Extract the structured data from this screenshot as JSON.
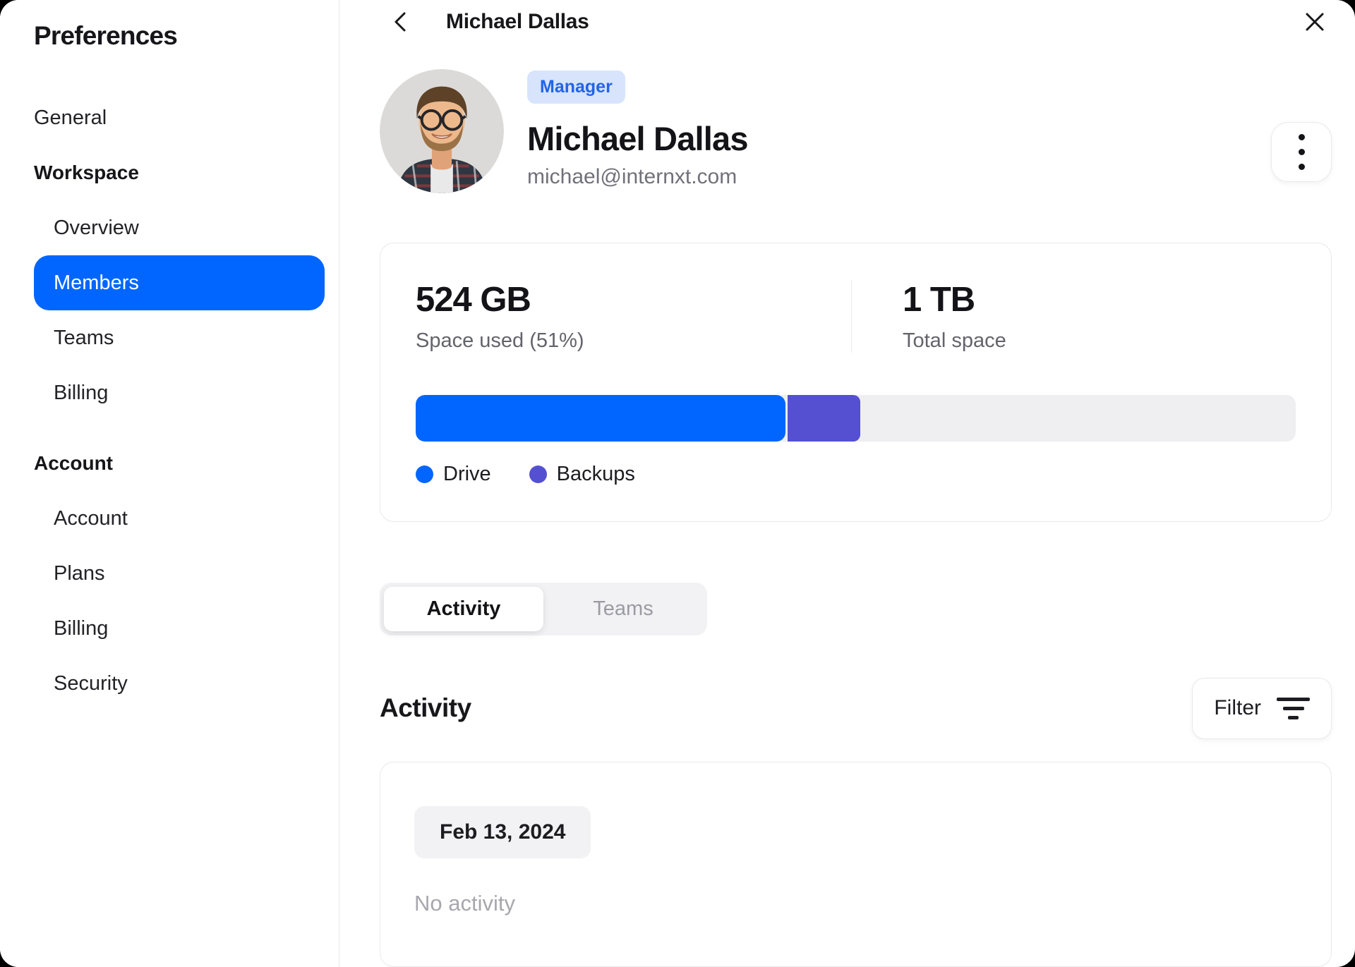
{
  "sidebar": {
    "title": "Preferences",
    "items": [
      {
        "label": "General"
      },
      {
        "label": "Workspace"
      },
      {
        "label": "Overview"
      },
      {
        "label": "Members"
      },
      {
        "label": "Teams"
      },
      {
        "label": "Billing"
      },
      {
        "label": "Account"
      },
      {
        "label": "Account"
      },
      {
        "label": "Plans"
      },
      {
        "label": "Billing"
      },
      {
        "label": "Security"
      }
    ],
    "selected_item": "Members"
  },
  "header": {
    "title": "Michael Dallas",
    "back_icon": "chevron-left-icon",
    "close_icon": "x-icon"
  },
  "profile": {
    "role_badge": "Manager",
    "name": "Michael Dallas",
    "email": "michael@internxt.com",
    "menu_icon": "kebab-menu-icon"
  },
  "storage": {
    "used_value": "524 GB",
    "used_label": "Space used (51%)",
    "total_value": "1 TB",
    "total_label": "Total space",
    "used_percent": 51,
    "segments": [
      {
        "name": "Drive",
        "color": "#0066ff",
        "percent": 42
      },
      {
        "name": "Backups",
        "color": "#5550d2",
        "percent": 8.3
      }
    ],
    "legend": [
      {
        "label": "Drive",
        "color": "#0066ff"
      },
      {
        "label": "Backups",
        "color": "#5550d2"
      }
    ]
  },
  "tabs": [
    {
      "label": "Activity",
      "active": true
    },
    {
      "label": "Teams",
      "active": false
    }
  ],
  "activity": {
    "heading": "Activity",
    "filter_label": "Filter",
    "filter_icon": "filter-lines-icon",
    "date_badge": "Feb 13, 2024",
    "empty_text": "No activity"
  },
  "colors": {
    "accent": "#0066ff",
    "backups": "#5550d2",
    "badge_bg": "#d7e4fc",
    "badge_text": "#2364e6",
    "border": "#e9e9eb",
    "track": "#efeff2",
    "text_secondary": "#71717a"
  }
}
